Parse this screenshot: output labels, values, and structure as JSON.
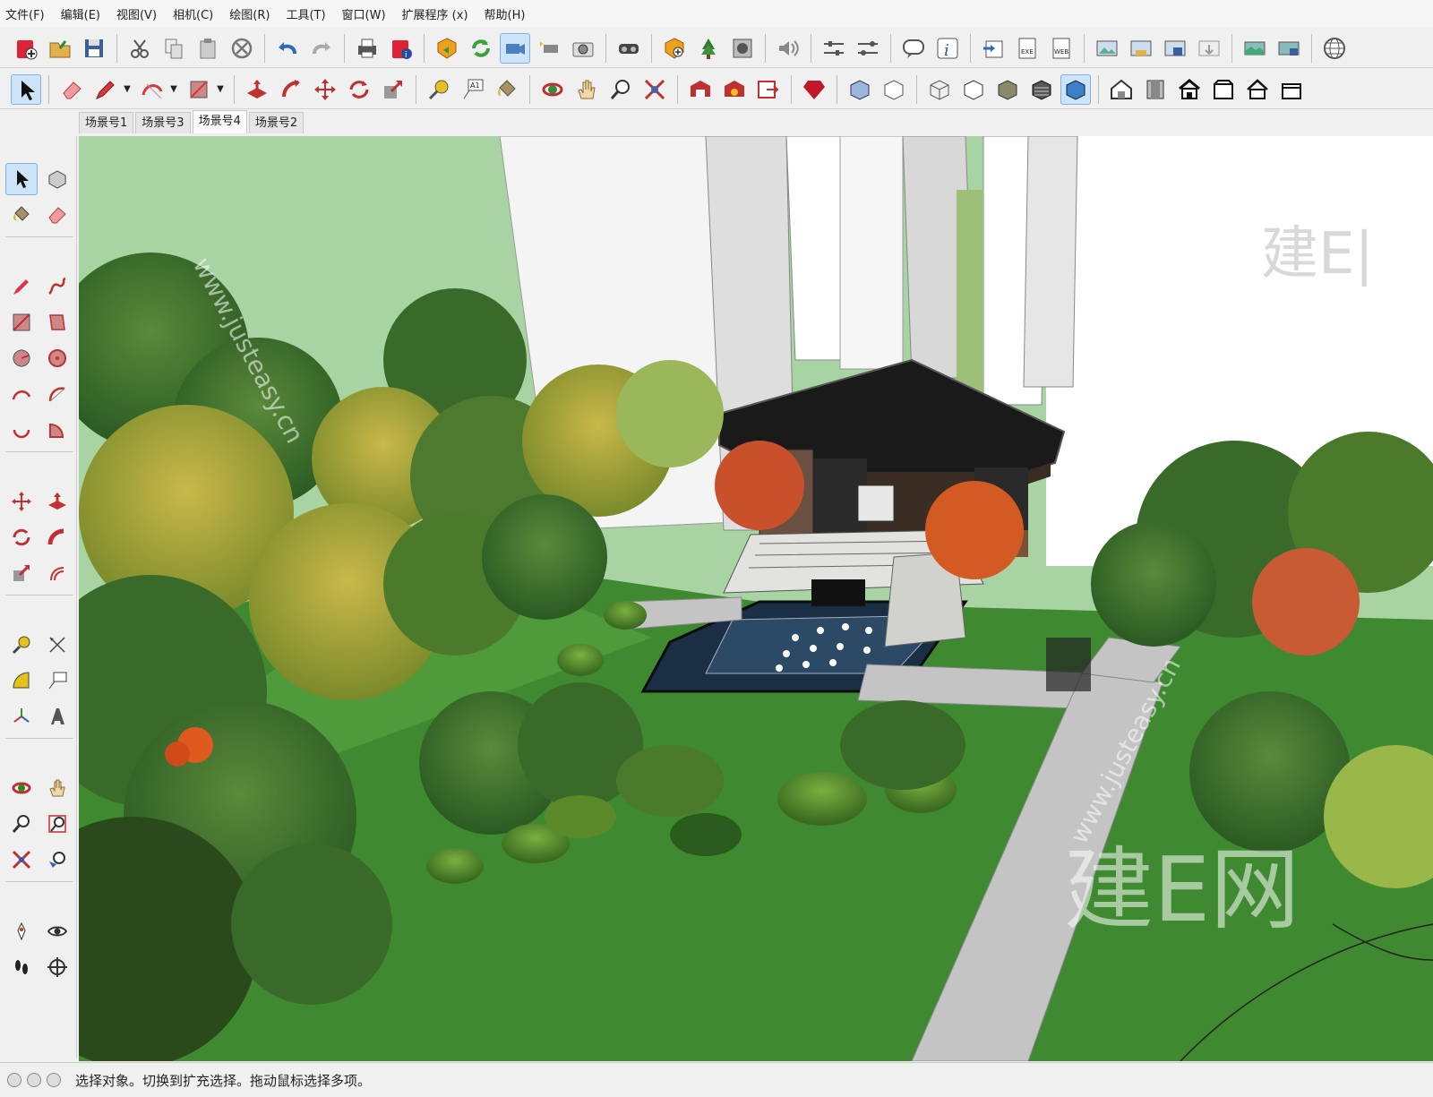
{
  "menus": [
    "文件(F)",
    "编辑(E)",
    "视图(V)",
    "相机(C)",
    "绘图(R)",
    "工具(T)",
    "窗口(W)",
    "扩展程序 (x)",
    "帮助(H)"
  ],
  "scene_tabs": [
    "场景号1",
    "场景号3",
    "场景号4",
    "场景号2"
  ],
  "active_scene_tab": "场景号4",
  "toolbar_text": {
    "exe_label": "EXE",
    "web_label": "WEB",
    "text_tool_label": "A1"
  },
  "status": {
    "text": "选择对象。切换到扩充选择。拖动鼠标选择多项。"
  },
  "watermarks": {
    "brand_cn": "建E网",
    "brand_cn_partial": "建E|",
    "site": "www.justeasy.cn"
  },
  "colors": {
    "lawn": "#3f8a30",
    "sky_panel": "#a8d4a4",
    "building": "#f4f4f4",
    "pavilion_roof": "#1a1a1a",
    "water": "#2b4a66",
    "path": "#c4c4c4",
    "active_tool": "#cde3f8"
  }
}
